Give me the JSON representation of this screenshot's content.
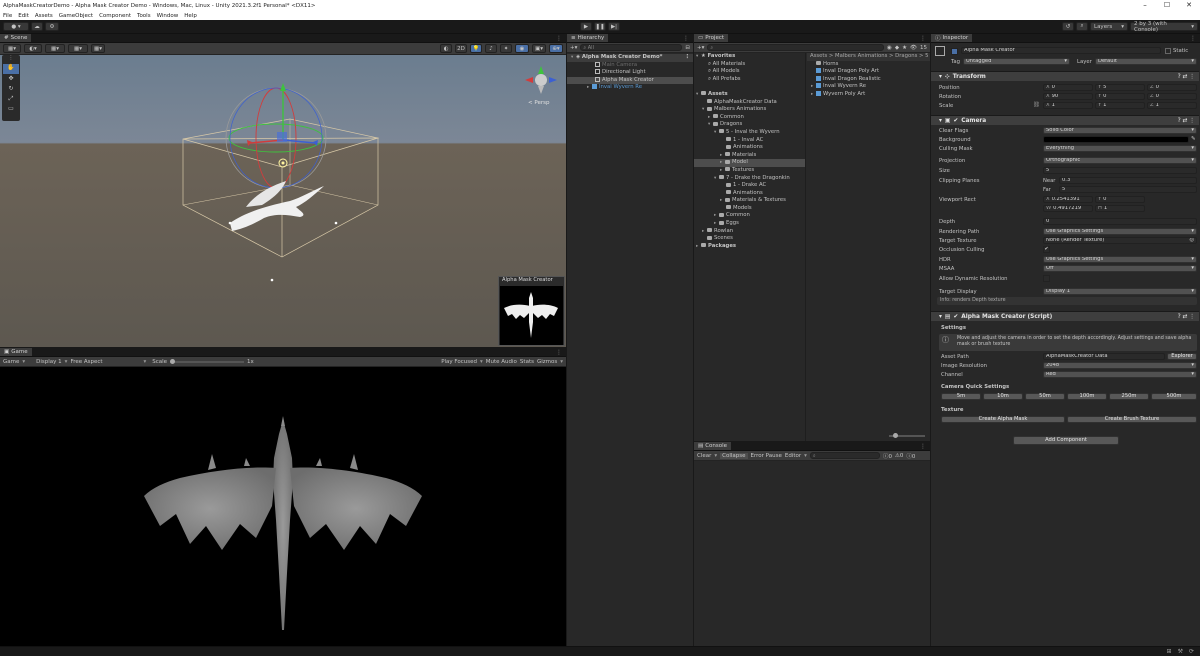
{
  "window": {
    "title": "AlphaMaskCreatorDemo - Alpha Mask Creator Demo - Windows, Mac, Linux - Unity 2021.3.2f1 Personal* <DX11>"
  },
  "menu": [
    "File",
    "Edit",
    "Assets",
    "GameObject",
    "Component",
    "Tools",
    "Window",
    "Help"
  ],
  "toolbar": {
    "layers": "Layers",
    "layout": "2 by 3 (with Console)"
  },
  "scene": {
    "tab": "Scene",
    "persp": "< Persp",
    "overlay_title": "Alpha Mask Creator"
  },
  "game": {
    "tab": "Game",
    "mode": "Game",
    "display": "Display 1",
    "aspect": "Free Aspect",
    "scale_label": "Scale",
    "scale_value": "1x",
    "play_focused": "Play Focused",
    "mute": "Mute Audio",
    "stats": "Stats",
    "gizmos": "Gizmos"
  },
  "hierarchy": {
    "tab": "Hierarchy",
    "search_placeholder": "All",
    "scene_name": "Alpha Mask Creator Demo*",
    "items": [
      "Main Camera",
      "Directional Light",
      "Alpha Mask Creator",
      "Inval Wyvern Re"
    ]
  },
  "project": {
    "tab": "Project",
    "count": "15",
    "favorites_label": "Favorites",
    "favorites": [
      "All Materials",
      "All Models",
      "All Prefabs"
    ],
    "tree": [
      "Assets",
      "AlphaMaskCreator Data",
      "Malbers Animations",
      "Common",
      "Dragons",
      "5 - Inval the Wyvern",
      "1 - Inval AC",
      "Animations",
      "Materials",
      "Model",
      "Textures",
      "7 - Drake the Dragonkin",
      "1 - Drake AC",
      "Animations",
      "Materials & Textures",
      "Models",
      "Common",
      "Eggs",
      "Rowlan",
      "Scenes",
      "Packages"
    ],
    "breadcrumb": "Assets > Malbers Animations > Dragons > 5",
    "files": [
      "Horns",
      "Inval Dragon Poly Art",
      "Inval Dragon Realistic",
      "Inval Wyvern Re",
      "Wyvern Poly Art"
    ]
  },
  "console": {
    "tab": "Console",
    "clear": "Clear",
    "collapse": "Collapse",
    "error_pause": "Error Pause",
    "editor": "Editor",
    "c1": "0",
    "c2": "0",
    "c3": "0"
  },
  "inspector": {
    "tab": "Inspector",
    "object_name": "Alpha Mask Creator",
    "static": "Static",
    "tag_label": "Tag",
    "tag": "Untagged",
    "layer_label": "Layer",
    "layer": "Default",
    "transform": {
      "title": "Transform",
      "position": "Position",
      "rotation": "Rotation",
      "scale": "Scale",
      "pos": [
        "0",
        "5",
        "0"
      ],
      "rot": [
        "90",
        "0",
        "0"
      ],
      "scl": [
        "1",
        "1",
        "1"
      ]
    },
    "camera": {
      "title": "Camera",
      "clear_flags": "Clear Flags",
      "clear_flags_value": "Solid Color",
      "background": "Background",
      "culling_mask": "Culling Mask",
      "culling_value": "Everything",
      "projection": "Projection",
      "projection_value": "Orthographic",
      "size": "Size",
      "size_value": "5",
      "clipping": "Clipping Planes",
      "near_label": "Near",
      "near": "0.3",
      "far_label": "Far",
      "far": "5",
      "viewport": "Viewport Rect",
      "vx": "0.2541391",
      "vy": "0",
      "vw": "0.4917219",
      "vh": "1",
      "depth": "Depth",
      "depth_value": "0",
      "rendering_path": "Rendering Path",
      "rendering_value": "Use Graphics Settings",
      "target_texture": "Target Texture",
      "target_value": "None (Render Texture)",
      "occlusion": "Occlusion Culling",
      "hdr": "HDR",
      "hdr_value": "Use Graphics Settings",
      "msaa": "MSAA",
      "msaa_value": "Off",
      "dynres": "Allow Dynamic Resolution",
      "target_display": "Target Display",
      "display_value": "Display 1",
      "info": "Info: renders Depth texture"
    },
    "script": {
      "title": "Alpha Mask Creator (Script)",
      "settings": "Settings",
      "help": "Move and adjust the camera in order to set the depth accordingly. Adjust settings and save alpha mask or brush texture",
      "asset_path": "Asset Path",
      "asset_value": "AlphaMaskCreator Data",
      "explorer": "Explorer",
      "image_res": "Image Resolution",
      "res_value": "2048",
      "channel": "Channel",
      "channel_value": "Red",
      "quick": "Camera Quick Settings",
      "quick_btns": [
        "5m",
        "10m",
        "50m",
        "100m",
        "250m",
        "500m"
      ],
      "texture": "Texture",
      "create_alpha": "Create Alpha Mask",
      "create_brush": "Create Brush Texture"
    },
    "add_component": "Add Component"
  },
  "colors": {
    "selection": "#3e5f8a",
    "panel": "#282828",
    "header": "#3c3c3c"
  }
}
